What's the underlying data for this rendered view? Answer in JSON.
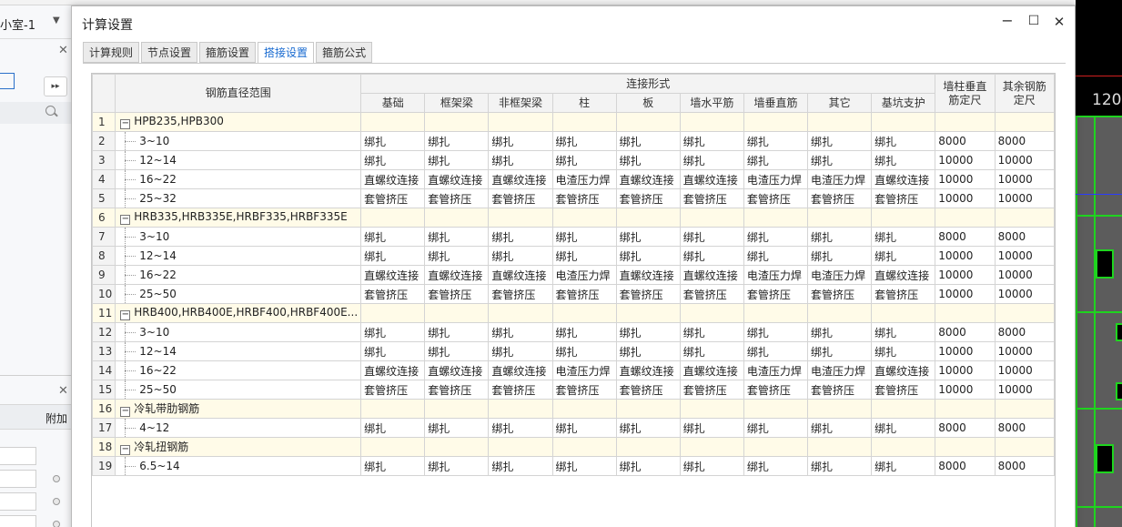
{
  "background": {
    "combo_label": "小室-1",
    "panel_header": "附加",
    "cad_number": "120"
  },
  "dialog": {
    "title": "计算设置",
    "tabs": [
      {
        "label": "计算规则",
        "active": false
      },
      {
        "label": "节点设置",
        "active": false
      },
      {
        "label": "箍筋设置",
        "active": false
      },
      {
        "label": "搭接设置",
        "active": true
      },
      {
        "label": "箍筋公式",
        "active": false
      }
    ],
    "accent_color": "#1a6bd0"
  },
  "table": {
    "header_range": "钢筋直径范围",
    "header_group": "连接形式",
    "columns": [
      "基础",
      "框架梁",
      "非框架梁",
      "柱",
      "板",
      "墙水平筋",
      "墙垂直筋",
      "其它",
      "基坑支护"
    ],
    "col_wall_vertical_length": "墙柱垂直筋定尺",
    "col_other_length": "其余钢筋定尺",
    "rows": [
      {
        "n": "1",
        "type": "group",
        "name": "HPB235,HPB300"
      },
      {
        "n": "2",
        "type": "item",
        "name": "3~10",
        "cells": [
          "绑扎",
          "绑扎",
          "绑扎",
          "绑扎",
          "绑扎",
          "绑扎",
          "绑扎",
          "绑扎",
          "绑扎"
        ],
        "l1": "8000",
        "l2": "8000"
      },
      {
        "n": "3",
        "type": "item",
        "name": "12~14",
        "cells": [
          "绑扎",
          "绑扎",
          "绑扎",
          "绑扎",
          "绑扎",
          "绑扎",
          "绑扎",
          "绑扎",
          "绑扎"
        ],
        "l1": "10000",
        "l2": "10000"
      },
      {
        "n": "4",
        "type": "item",
        "name": "16~22",
        "cells": [
          "直螺纹连接",
          "直螺纹连接",
          "直螺纹连接",
          "电渣压力焊",
          "直螺纹连接",
          "直螺纹连接",
          "电渣压力焊",
          "电渣压力焊",
          "直螺纹连接"
        ],
        "l1": "10000",
        "l2": "10000"
      },
      {
        "n": "5",
        "type": "item",
        "name": "25~32",
        "cells": [
          "套管挤压",
          "套管挤压",
          "套管挤压",
          "套管挤压",
          "套管挤压",
          "套管挤压",
          "套管挤压",
          "套管挤压",
          "套管挤压"
        ],
        "l1": "10000",
        "l2": "10000"
      },
      {
        "n": "6",
        "type": "group",
        "name": "HRB335,HRB335E,HRBF335,HRBF335E"
      },
      {
        "n": "7",
        "type": "item",
        "name": "3~10",
        "cells": [
          "绑扎",
          "绑扎",
          "绑扎",
          "绑扎",
          "绑扎",
          "绑扎",
          "绑扎",
          "绑扎",
          "绑扎"
        ],
        "l1": "8000",
        "l2": "8000"
      },
      {
        "n": "8",
        "type": "item",
        "name": "12~14",
        "cells": [
          "绑扎",
          "绑扎",
          "绑扎",
          "绑扎",
          "绑扎",
          "绑扎",
          "绑扎",
          "绑扎",
          "绑扎"
        ],
        "l1": "10000",
        "l2": "10000"
      },
      {
        "n": "9",
        "type": "item",
        "name": "16~22",
        "cells": [
          "直螺纹连接",
          "直螺纹连接",
          "直螺纹连接",
          "电渣压力焊",
          "直螺纹连接",
          "直螺纹连接",
          "电渣压力焊",
          "电渣压力焊",
          "直螺纹连接"
        ],
        "l1": "10000",
        "l2": "10000"
      },
      {
        "n": "10",
        "type": "item",
        "name": "25~50",
        "cells": [
          "套管挤压",
          "套管挤压",
          "套管挤压",
          "套管挤压",
          "套管挤压",
          "套管挤压",
          "套管挤压",
          "套管挤压",
          "套管挤压"
        ],
        "l1": "10000",
        "l2": "10000"
      },
      {
        "n": "11",
        "type": "group",
        "name": "HRB400,HRB400E,HRBF400,HRBF400E..."
      },
      {
        "n": "12",
        "type": "item",
        "name": "3~10",
        "cells": [
          "绑扎",
          "绑扎",
          "绑扎",
          "绑扎",
          "绑扎",
          "绑扎",
          "绑扎",
          "绑扎",
          "绑扎"
        ],
        "l1": "8000",
        "l2": "8000"
      },
      {
        "n": "13",
        "type": "item",
        "name": "12~14",
        "cells": [
          "绑扎",
          "绑扎",
          "绑扎",
          "绑扎",
          "绑扎",
          "绑扎",
          "绑扎",
          "绑扎",
          "绑扎"
        ],
        "l1": "10000",
        "l2": "10000"
      },
      {
        "n": "14",
        "type": "item",
        "name": "16~22",
        "cells": [
          "直螺纹连接",
          "直螺纹连接",
          "直螺纹连接",
          "电渣压力焊",
          "直螺纹连接",
          "直螺纹连接",
          "电渣压力焊",
          "电渣压力焊",
          "直螺纹连接"
        ],
        "l1": "10000",
        "l2": "10000"
      },
      {
        "n": "15",
        "type": "item",
        "name": "25~50",
        "cells": [
          "套管挤压",
          "套管挤压",
          "套管挤压",
          "套管挤压",
          "套管挤压",
          "套管挤压",
          "套管挤压",
          "套管挤压",
          "套管挤压"
        ],
        "l1": "10000",
        "l2": "10000"
      },
      {
        "n": "16",
        "type": "group",
        "name": "冷轧带肋钢筋"
      },
      {
        "n": "17",
        "type": "item",
        "name": "4~12",
        "cells": [
          "绑扎",
          "绑扎",
          "绑扎",
          "绑扎",
          "绑扎",
          "绑扎",
          "绑扎",
          "绑扎",
          "绑扎"
        ],
        "l1": "8000",
        "l2": "8000"
      },
      {
        "n": "18",
        "type": "group",
        "name": "冷轧扭钢筋"
      },
      {
        "n": "19",
        "type": "item",
        "name": "6.5~14",
        "cells": [
          "绑扎",
          "绑扎",
          "绑扎",
          "绑扎",
          "绑扎",
          "绑扎",
          "绑扎",
          "绑扎",
          "绑扎"
        ],
        "l1": "8000",
        "l2": "8000"
      }
    ]
  }
}
